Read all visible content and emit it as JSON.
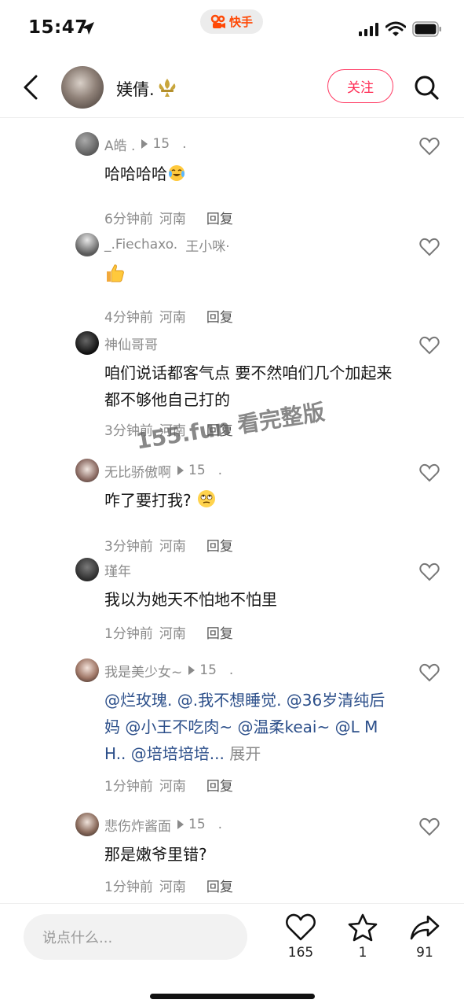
{
  "status_bar": {
    "time": "15:47",
    "app_label": "快手"
  },
  "header": {
    "username": "媄倩.",
    "follow_label": "关注"
  },
  "comments": [
    {
      "name": "A皓 .",
      "views": "15",
      "trail": ".",
      "text": "哈哈哈哈",
      "emoji": "laugh-cry-emoji",
      "time": "6分钟前",
      "location": "河南",
      "reply_label": "回复"
    },
    {
      "name": "_.Fiechaxo.",
      "views": "",
      "trail": "王小咪·",
      "text": "",
      "emoji": "thumbs-up-emoji",
      "time": "4分钟前",
      "location": "河南",
      "reply_label": "回复"
    },
    {
      "name": "神仙哥哥",
      "views": "",
      "trail": "",
      "text": "咱们说话都客气点 要不然咱们几个加起来都不够他自己打的",
      "emoji": "",
      "time": "3分钟前",
      "location": "河南",
      "reply_label": "回复"
    },
    {
      "name": "无比骄傲啊",
      "views": "15",
      "trail": ".",
      "text": "咋了要打我?",
      "emoji": "rolling-eyes-emoji",
      "time": "3分钟前",
      "location": "河南",
      "reply_label": "回复"
    },
    {
      "name": "瑾年",
      "views": "",
      "trail": "",
      "text": "我以为她天不怕地不怕里",
      "emoji": "",
      "time": "1分钟前",
      "location": "河南",
      "reply_label": "回复"
    },
    {
      "name": "我是美少女~",
      "views": "15",
      "trail": ".",
      "text": "@烂玫瑰. @.我不想睡觉. @36岁清纯后妈 @小王不吃肉~ @温柔keai~ @L M H.. @培培培培...",
      "expand_label": "展开",
      "emoji": "",
      "time": "1分钟前",
      "location": "河南",
      "reply_label": "回复"
    },
    {
      "name": "悲伤炸酱面",
      "views": "15",
      "trail": ".",
      "text": "那是嫩爷里错?",
      "emoji": "",
      "time": "1分钟前",
      "location": "河南",
      "reply_label": "回复"
    }
  ],
  "watermark": "155.fun 看完整版",
  "bottom_bar": {
    "input_placeholder": "说点什么...",
    "likes": "165",
    "favorites": "1",
    "shares": "91"
  },
  "colors": {
    "accent": "#ff2d55",
    "brand": "#ff4906",
    "muted": "#8a8a8a"
  }
}
